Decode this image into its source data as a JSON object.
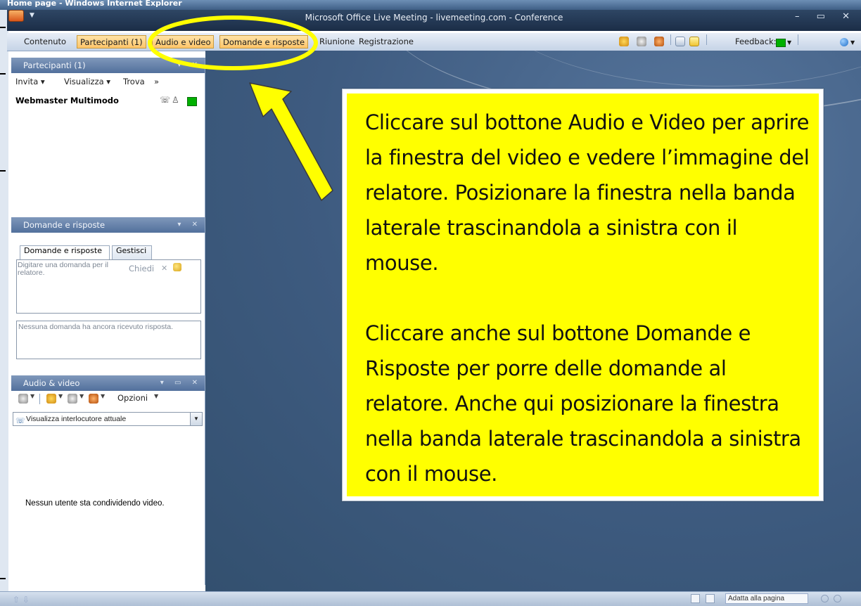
{
  "ie_window": {
    "title": "Home page - Windows Internet Explorer"
  },
  "livemeeting": {
    "title": "Microsoft Office Live Meeting - livemeeting.com - Conference",
    "window_controls": "– ▭ ✕"
  },
  "menubar": {
    "items": [
      {
        "label": "Contenuto",
        "selected": false
      },
      {
        "label": "Partecipanti (1)",
        "selected": true
      },
      {
        "label": "Audio e video",
        "selected": true
      },
      {
        "label": "Domande e risposte",
        "selected": true
      },
      {
        "label": "Riunione",
        "selected": false
      },
      {
        "label": "Registrazione",
        "selected": false
      }
    ],
    "feedback_label": "Feedback:",
    "feedback_color": "#00b000",
    "right_icons": [
      "speaker-icon",
      "microphone-icon",
      "webcam-icon",
      "handout-icon",
      "notes-icon"
    ]
  },
  "participants_panel": {
    "title": "Partecipanti (1)",
    "controls": "▾ ✕",
    "toolbar": {
      "invite": "Invita ▾",
      "view": "Visualizza ▾",
      "find": "Trova",
      "more": "»"
    },
    "users": [
      {
        "name": "Webmaster Multimodo",
        "status_color": "#00b000",
        "icons": [
          "phone-icon",
          "presenter-icon"
        ]
      }
    ]
  },
  "qa_panel": {
    "title": "Domande e risposte",
    "controls": "▾ ✕",
    "tabs": [
      "Domande e risposte",
      "Gestisci"
    ],
    "question_placeholder": "Digitare una domanda per il relatore.",
    "ask_button": "Chiedi",
    "answers_placeholder": "Nessuna domanda ha ancora ricevuto risposta."
  },
  "av_panel": {
    "title": "Audio & video",
    "controls": "▾ ▭ ✕",
    "options_label": "Opzioni",
    "view_select": "Visualizza interlocutore attuale",
    "no_video_message": "Nessun utente sta condividendo video."
  },
  "callout": {
    "paragraph1": "Cliccare sul bottone Audio e Video per aprire la finestra del video e vedere l’immagine del relatore. Posizionare la finestra nella banda laterale trascinandola a sinistra con il mouse.",
    "paragraph2": "Cliccare anche sul bottone Domande e Risposte per porre delle domande al relatore. Anche qui posizionare la finestra nella banda laterale trascinandola a sinistra con il mouse.",
    "background_color": "#ffff00"
  },
  "statusbar": {
    "zoom_label": "Adatta alla pagina"
  },
  "annotation": {
    "highlight_color": "#ffff00",
    "arrow_color": "#ffff00"
  }
}
